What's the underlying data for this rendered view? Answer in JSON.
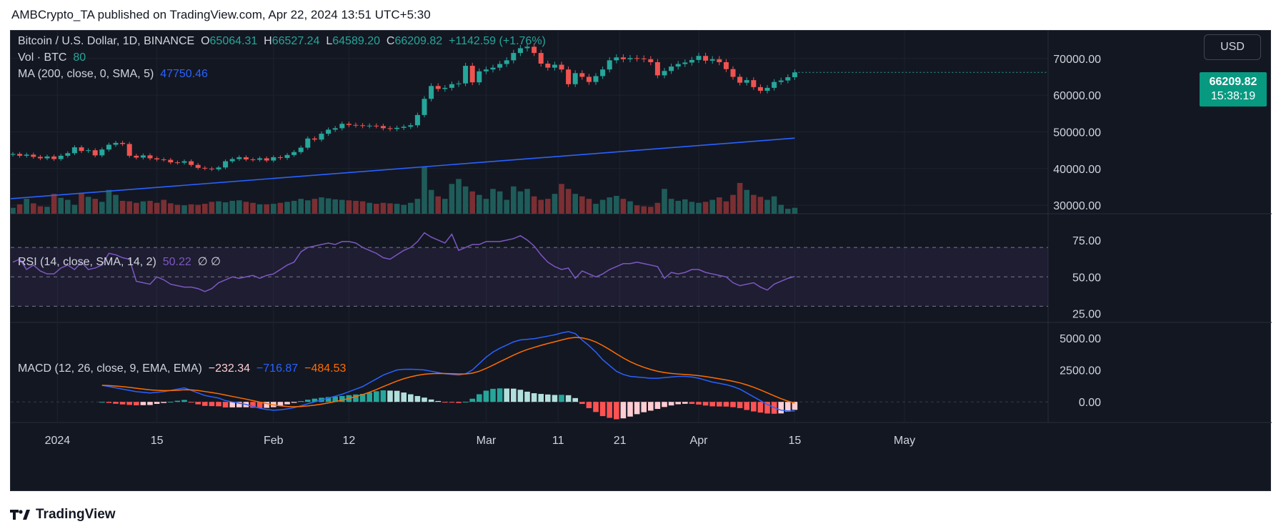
{
  "header": {
    "text": "AMBCrypto_TA published on TradingView.com, Apr 22, 2024 13:51 UTC+5:30"
  },
  "footer": {
    "brand": "TradingView",
    "logo_icon": "tradingview-logo-icon"
  },
  "colors": {
    "bg": "#131722",
    "up": "#26a69a",
    "down": "#ef5350",
    "vol_up": "#1f5c59",
    "vol_down": "#7a2f33",
    "ma": "#2962ff",
    "rsi": "#7e57c2",
    "macd": "#2962ff",
    "signal": "#ff6d00",
    "hist_up_strong": "#26a69a",
    "hist_up_weak": "#b2dfdb",
    "hist_down_strong": "#ff5252",
    "hist_down_weak": "#ffcdd2"
  },
  "legend": {
    "symbol": "Bitcoin / U.S. Dollar, 1D, BINANCE",
    "o_label": "O",
    "o": "65064.31",
    "h_label": "H",
    "h": "66527.24",
    "l_label": "L",
    "l": "64589.20",
    "c_label": "C",
    "c": "66209.82",
    "change": "+1142.59 (+1.76%)",
    "vol_label": "Vol · BTC",
    "vol": "80",
    "ma_label": "MA (200, close, 0, SMA, 5)",
    "ma": "47750.46",
    "rsi_label": "RSI (14, close, SMA, 14, 2)",
    "rsi": "50.22",
    "rsi_extra": "∅  ∅",
    "macd_label": "MACD (12, 26, close, 9, EMA, EMA)",
    "macd_hist": "−232.34",
    "macd_line": "−716.87",
    "macd_signal": "−484.53"
  },
  "currency_button": "USD",
  "last_price": {
    "price": "66209.82",
    "countdown": "15:38:19"
  },
  "chart_data": {
    "type": "candlestick",
    "title": "Bitcoin / U.S. Dollar, 1D, BINANCE",
    "x_ticks": [
      "2024",
      "15",
      "Feb",
      "12",
      "Mar",
      "11",
      "21",
      "Apr",
      "15",
      "May"
    ],
    "x_tick_index": [
      6.5,
      21,
      38,
      49,
      69,
      79.5,
      88.5,
      100,
      114,
      130
    ],
    "price_axis": {
      "ticks": [
        "70000.00",
        "60000.00",
        "50000.00",
        "40000.00",
        "30000.00"
      ],
      "range": [
        27700,
        76000
      ]
    },
    "rsi_axis": {
      "ticks": [
        "75.00",
        "50.00",
        "25.00"
      ],
      "range": [
        20,
        90
      ],
      "band": [
        30,
        70
      ]
    },
    "macd_axis": {
      "ticks": [
        "5000.00",
        "2500.00",
        "0.00"
      ],
      "range": [
        -1500,
        6000
      ]
    },
    "closes": [
      44000,
      43500,
      43800,
      43200,
      42800,
      43300,
      42600,
      43500,
      44200,
      45800,
      44800,
      45000,
      43600,
      45200,
      46500,
      47000,
      46700,
      43500,
      43000,
      43600,
      42800,
      42500,
      42400,
      41700,
      41600,
      42000,
      41000,
      40200,
      40000,
      39800,
      40300,
      42000,
      42600,
      43100,
      42500,
      42400,
      42800,
      42200,
      43100,
      42900,
      43700,
      44500,
      45700,
      48200,
      47900,
      49500,
      50600,
      51000,
      52200,
      51900,
      51800,
      51600,
      51700,
      51600,
      51000,
      50800,
      51100,
      51400,
      51800,
      54600,
      59000,
      62500,
      61700,
      62000,
      63000,
      63200,
      68000,
      63500,
      66500,
      67000,
      67500,
      68500,
      69500,
      71500,
      72800,
      73200,
      71500,
      68600,
      67500,
      68300,
      67000,
      63000,
      66000,
      65000,
      63600,
      65200,
      67000,
      69500,
      70300,
      69800,
      70100,
      70000,
      69800,
      69000,
      65400,
      66600,
      67800,
      68500,
      68900,
      69600,
      70700,
      69400,
      69800,
      69000,
      67100,
      65000,
      63400,
      64100,
      62200,
      61200,
      62000,
      63600,
      64000,
      64900,
      66209
    ],
    "ma200": [
      31800,
      48300
    ],
    "volume": [
      12,
      19,
      30,
      21,
      15,
      14,
      40,
      32,
      28,
      18,
      42,
      34,
      30,
      24,
      48,
      38,
      26,
      25,
      22,
      25,
      26,
      22,
      28,
      21,
      18,
      17,
      19,
      18,
      20,
      24,
      25,
      23,
      26,
      27,
      24,
      22,
      19,
      19,
      20,
      22,
      24,
      26,
      30,
      27,
      30,
      33,
      31,
      29,
      28,
      27,
      26,
      25,
      22,
      20,
      22,
      21,
      20,
      18,
      22,
      30,
      95,
      48,
      35,
      30,
      60,
      70,
      55,
      45,
      38,
      30,
      50,
      45,
      28,
      55,
      45,
      50,
      35,
      28,
      30,
      40,
      60,
      50,
      40,
      35,
      30,
      20,
      28,
      33,
      36,
      30,
      25,
      17,
      15,
      14,
      22,
      50,
      30,
      26,
      29,
      24,
      22,
      24,
      28,
      33,
      25,
      38,
      62,
      48,
      38,
      34,
      28,
      35,
      18,
      10,
      12
    ],
    "rsi": [
      60,
      62,
      55,
      58,
      54,
      52,
      52,
      56,
      58,
      55,
      60,
      55,
      56,
      58,
      66,
      65,
      63,
      62,
      47,
      46,
      45,
      50,
      48,
      45,
      44,
      43,
      43,
      42,
      40,
      42,
      46,
      48,
      50,
      49,
      50,
      51,
      49,
      51,
      52,
      55,
      58,
      60,
      67,
      70,
      71,
      72,
      73,
      72,
      74,
      74,
      73,
      70,
      68,
      66,
      63,
      62,
      65,
      68,
      70,
      74,
      80,
      77,
      75,
      73,
      79,
      68,
      70,
      72,
      72,
      74,
      74,
      74,
      75,
      76,
      78,
      75,
      71,
      65,
      60,
      57,
      55,
      56,
      49,
      54,
      52,
      50,
      52,
      55,
      57,
      59,
      59,
      60,
      59,
      58,
      57,
      49,
      53,
      52,
      53,
      55,
      55,
      53,
      52,
      51,
      50,
      46,
      44,
      45,
      46,
      43,
      41,
      45,
      47,
      49,
      50.22
    ],
    "macd": [
      1300,
      1200,
      1100,
      1000,
      900,
      800,
      750,
      700,
      750,
      800,
      900,
      1000,
      1100,
      900,
      700,
      500,
      400,
      300,
      100,
      0,
      -100,
      -200,
      -350,
      -500,
      -600,
      -650,
      -620,
      -550,
      -450,
      -300,
      -150,
      0,
      150,
      300,
      450,
      600,
      800,
      1000,
      1200,
      1500,
      1800,
      2100,
      2300,
      2500,
      2550,
      2560,
      2540,
      2500,
      2400,
      2300,
      2200,
      2150,
      2100,
      2200,
      2500,
      3000,
      3500,
      3900,
      4200,
      4450,
      4700,
      4850,
      4900,
      4950,
      5050,
      5150,
      5250,
      5400,
      5500,
      5350,
      4850,
      4400,
      3900,
      3300,
      2850,
      2400,
      2150,
      2000,
      1950,
      1900,
      1850,
      1850,
      1900,
      1950,
      2000,
      2000,
      1950,
      1850,
      1700,
      1550,
      1450,
      1350,
      1200,
      1000,
      700,
      400,
      100,
      -200,
      -450,
      -650,
      -700,
      -717
    ]
  }
}
